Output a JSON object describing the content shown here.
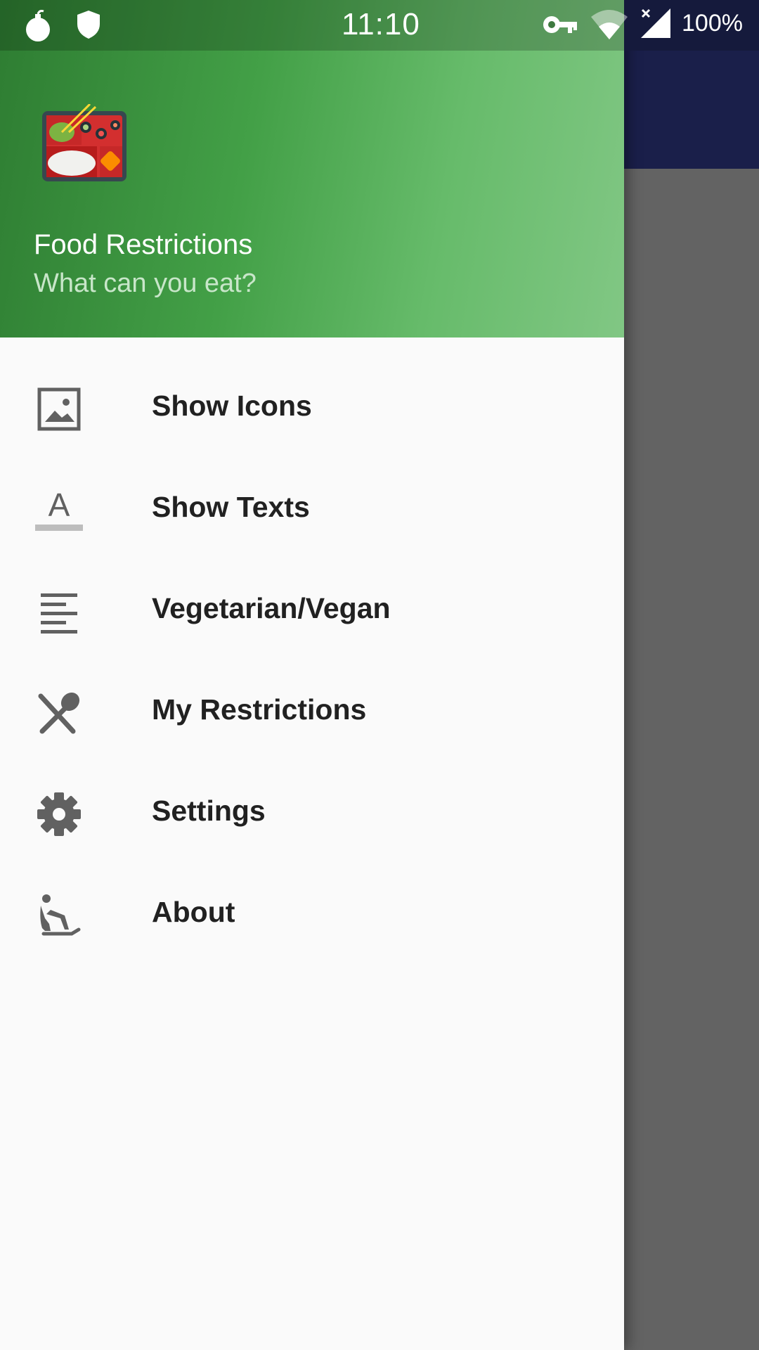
{
  "status_bar": {
    "time": "11:10",
    "battery": "100%",
    "left_icons": [
      "bomb-icon",
      "shield-icon"
    ],
    "right_icons": [
      "key-icon",
      "wifi-icon",
      "signal-icon"
    ]
  },
  "drawer": {
    "header": {
      "title": "Food Restrictions",
      "subtitle": "What can you eat?",
      "logo": "bento-box-icon"
    },
    "items": [
      {
        "label": "Show Icons",
        "icon": "image-icon"
      },
      {
        "label": "Show Texts",
        "icon": "text-format-icon"
      },
      {
        "label": "Vegetarian/Vegan",
        "icon": "align-left-icon"
      },
      {
        "label": "My Restrictions",
        "icon": "restaurant-icon"
      },
      {
        "label": "Settings",
        "icon": "gear-icon"
      },
      {
        "label": "About",
        "icon": "seat-person-icon"
      }
    ]
  },
  "colors": {
    "header_start": "#2e7d32",
    "header_end": "#81c784",
    "background_appbar": "#1a1f4a",
    "icon_gray": "#616161"
  }
}
